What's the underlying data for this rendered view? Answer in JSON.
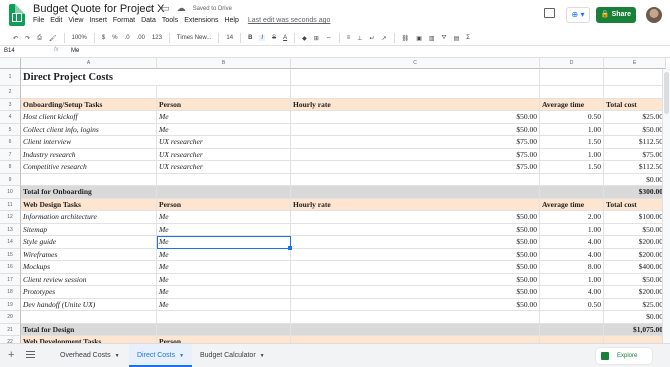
{
  "app": {
    "doc_title": "Budget Quote for Project X",
    "saved_status": "Saved to Drive",
    "menu": [
      "File",
      "Edit",
      "View",
      "Insert",
      "Format",
      "Data",
      "Tools",
      "Extensions",
      "Help"
    ],
    "last_edit": "Last edit was seconds ago",
    "share_label": "Share",
    "present_icon": "add-comment-icon"
  },
  "toolbar": {
    "zoom": "100%",
    "currency": "$",
    "percent": "%",
    "dec_less": ".0",
    "dec_more": ".00",
    "number_format": "123",
    "font": "Times New...",
    "font_size": "14",
    "bold": "B",
    "italic": "I",
    "strike": "S",
    "text_color": "A",
    "sigma": "Σ"
  },
  "formula_bar": {
    "cell_ref": "B14",
    "fx": "fx",
    "value": "Me"
  },
  "columns": [
    "A",
    "B",
    "C",
    "D",
    "E"
  ],
  "rows": [
    {
      "n": "1",
      "type": "title",
      "cells": [
        "Direct Project Costs",
        "",
        "",
        "",
        ""
      ]
    },
    {
      "n": "2",
      "type": "blank",
      "cells": [
        "",
        "",
        "",
        "",
        ""
      ]
    },
    {
      "n": "3",
      "type": "header",
      "cells": [
        "Onboarding/Setup Tasks",
        "Person",
        "Hourly rate",
        "Average time",
        "Total cost"
      ]
    },
    {
      "n": "4",
      "type": "data",
      "cells": [
        "Host client kickoff",
        "Me",
        "$50.00",
        "0.50",
        "$25.00"
      ]
    },
    {
      "n": "5",
      "type": "data",
      "cells": [
        "Collect client info, logins",
        "Me",
        "$50.00",
        "1.00",
        "$50.00"
      ]
    },
    {
      "n": "6",
      "type": "data",
      "cells": [
        "Client interview",
        "UX researcher",
        "$75.00",
        "1.50",
        "$112.50"
      ]
    },
    {
      "n": "7",
      "type": "data",
      "cells": [
        "Industry research",
        "UX researcher",
        "$75.00",
        "1.00",
        "$75.00"
      ]
    },
    {
      "n": "8",
      "type": "data",
      "cells": [
        "Competitive research",
        "UX researcher",
        "$75.00",
        "1.50",
        "$112.50"
      ]
    },
    {
      "n": "9",
      "type": "blank",
      "cells": [
        "",
        "",
        "",
        "",
        "$0.00"
      ]
    },
    {
      "n": "10",
      "type": "total",
      "cells": [
        "Total for Onboarding",
        "",
        "",
        "",
        "$300.00"
      ]
    },
    {
      "n": "11",
      "type": "header",
      "cells": [
        "Web Design Tasks",
        "Person",
        "Hourly rate",
        "Average time",
        "Total cost"
      ]
    },
    {
      "n": "12",
      "type": "data",
      "cells": [
        "Information architecture",
        "Me",
        "$50.00",
        "2.00",
        "$100.00"
      ]
    },
    {
      "n": "13",
      "type": "data",
      "cells": [
        "Sitemap",
        "Me",
        "$50.00",
        "1.00",
        "$50.00"
      ]
    },
    {
      "n": "14",
      "type": "data",
      "cells": [
        "Style guide",
        "Me",
        "$50.00",
        "4.00",
        "$200.00"
      ]
    },
    {
      "n": "15",
      "type": "data",
      "cells": [
        "Wireframes",
        "Me",
        "$50.00",
        "4.00",
        "$200.00"
      ]
    },
    {
      "n": "16",
      "type": "data",
      "cells": [
        "Mockups",
        "Me",
        "$50.00",
        "8.00",
        "$400.00"
      ]
    },
    {
      "n": "17",
      "type": "data",
      "cells": [
        "Client review session",
        "Me",
        "$50.00",
        "1.00",
        "$50.00"
      ]
    },
    {
      "n": "18",
      "type": "data",
      "cells": [
        "Prototypes",
        "Me",
        "$50.00",
        "4.00",
        "$200.00"
      ]
    },
    {
      "n": "19",
      "type": "data",
      "cells": [
        "Dev handoff (Unite UX)",
        "Me",
        "$50.00",
        "0.50",
        "$25.00"
      ]
    },
    {
      "n": "20",
      "type": "blank",
      "cells": [
        "",
        "",
        "",
        "",
        "$0.00"
      ]
    },
    {
      "n": "21",
      "type": "total",
      "cells": [
        "Total for Design",
        "",
        "",
        "",
        "$1,075.00"
      ]
    },
    {
      "n": "22",
      "type": "header",
      "cells": [
        "Web Development Tasks",
        "Person",
        "",
        "",
        ""
      ]
    }
  ],
  "tabs": [
    {
      "label": "Overhead Costs",
      "active": false
    },
    {
      "label": "Direct Costs",
      "active": true
    },
    {
      "label": "Budget Calculator",
      "active": false
    }
  ],
  "explore_label": "Explore",
  "colors": {
    "header_fill": "#fde5cf",
    "total_fill": "#d9d9d9",
    "accent": "#1a73e8",
    "share_green": "#188038"
  }
}
